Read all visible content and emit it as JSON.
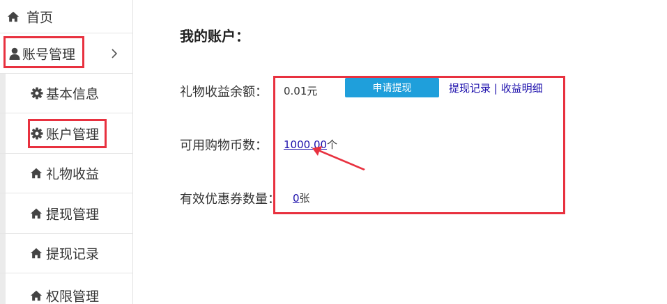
{
  "sidebar": {
    "home": "首页",
    "account_management": "账号管理",
    "items": [
      {
        "label": "基本信息"
      },
      {
        "label": "账户管理"
      },
      {
        "label": "礼物收益"
      },
      {
        "label": "提现管理"
      },
      {
        "label": "提现记录"
      },
      {
        "label": "权限管理"
      }
    ]
  },
  "main": {
    "title": "我的账户：",
    "gift_balance_label": "礼物收益余额：",
    "gift_balance_value": "0.01元",
    "apply_button": "申请提现",
    "withdraw_record_link": "提现记录",
    "separator": "|",
    "income_detail_link": "收益明细",
    "coins_label": "可用购物币数：",
    "coins_value": "1000.00",
    "coins_unit": "个",
    "coupon_label": "有效优惠券数量：",
    "coupon_value": "0",
    "coupon_unit": "张"
  },
  "colors": {
    "accent_button": "#1f9fdb",
    "highlight_red": "#e8313f",
    "link": "#1a0dab"
  }
}
